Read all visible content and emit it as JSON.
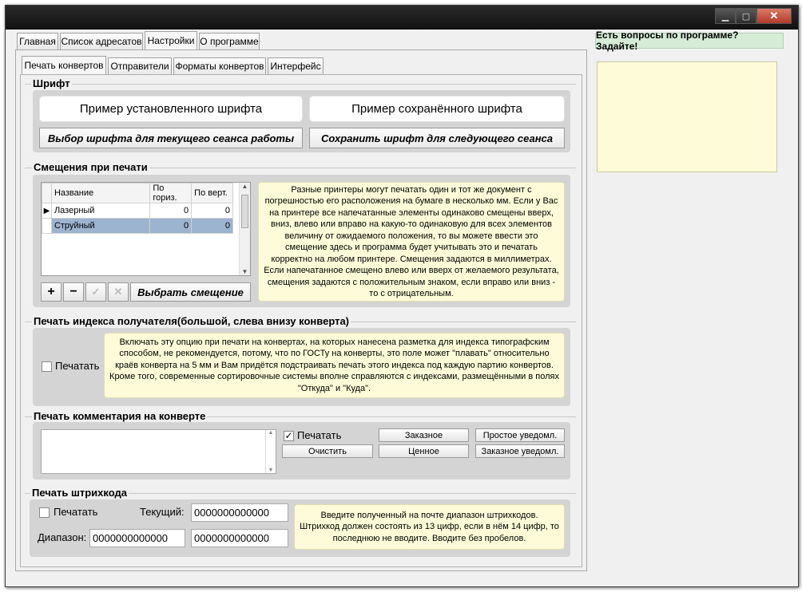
{
  "main_tabs": [
    "Главная",
    "Список адресатов",
    "Настройки",
    "О программе"
  ],
  "help_banner": "Есть вопросы по программе? Задайте!",
  "sub_tabs": [
    "Печать конвертов",
    "Отправители",
    "Форматы конвертов",
    "Интерфейс"
  ],
  "font_group": {
    "title": "Шрифт",
    "installed_sample": "Пример установленного шрифта",
    "saved_sample": "Пример сохранённого шрифта",
    "choose_button": "Выбор шрифта для текущего сеанса работы",
    "save_button": "Сохранить шрифт для следующего сеанса"
  },
  "offsets_group": {
    "title": "Смещения при печати",
    "columns": [
      "Название",
      "По гориз.",
      "По верт."
    ],
    "rows": [
      {
        "name": "Лазерный",
        "h": "0",
        "v": "0"
      },
      {
        "name": "Струйный",
        "h": "0",
        "v": "0"
      }
    ],
    "choose_button": "Выбрать смещение",
    "note": "Разные принтеры могут печатать один и тот же документ с погрешностью его расположения на бумаге в несколько мм. Если у Вас на принтере все напечатанные элементы одинаково смещены вверх, вниз, влево или вправо на какую-то одинаковую для всех элементов величину от ожидаемого положения, то вы можете ввести это смещение здесь и программа будет учитывать это и печатать корректно на любом принтере. Смещения задаются в миллиметрах. Если напечатанное смещено влево или вверх от желаемого результата, смещения задаются с положительным знаком, если вправо или вниз - то с отрицательным."
  },
  "index_group": {
    "title": "Печать индекса получателя(большой, слева внизу конверта)",
    "print_label": "Печатать",
    "note": "Включать эту опцию при печати на конвертах, на которых нанесена разметка для индекса типографским способом, не рекомендуется, потому, что по ГОСТу на конверты, это поле может \"плавать\" относительно краёв конверта на 5 мм и Вам придётся подстраивать печать этого индекса под каждую партию конвертов. Кроме того, современные сортировочные системы вполне справляются с индексами, размещёнными в полях \"Откуда\" и \"Куда\"."
  },
  "comment_group": {
    "title": "Печать комментария на конверте",
    "print_label": "Печатать",
    "clear_button": "Очистить",
    "registered_button": "Заказное",
    "valuable_button": "Ценное",
    "simple_notice_button": "Простое уведомл.",
    "registered_notice_button": "Заказное уведомл."
  },
  "barcode_group": {
    "title": "Печать штрихкода",
    "print_label": "Печатать",
    "current_label": "Текущий:",
    "current_value": "0000000000000",
    "range_label": "Диапазон:",
    "range_from": "0000000000000",
    "range_to": "0000000000000",
    "note": "Введите полученный на почте диапазон штрихкодов. Штрихкод должен состоять из 13 цифр, если в нём 14 цифр, то последнюю не вводите. Вводите без пробелов."
  },
  "colors": {
    "note_bg": "#fdfbd8",
    "banner_bg": "#d6ecd6",
    "selected_row": "#9db4d0"
  }
}
